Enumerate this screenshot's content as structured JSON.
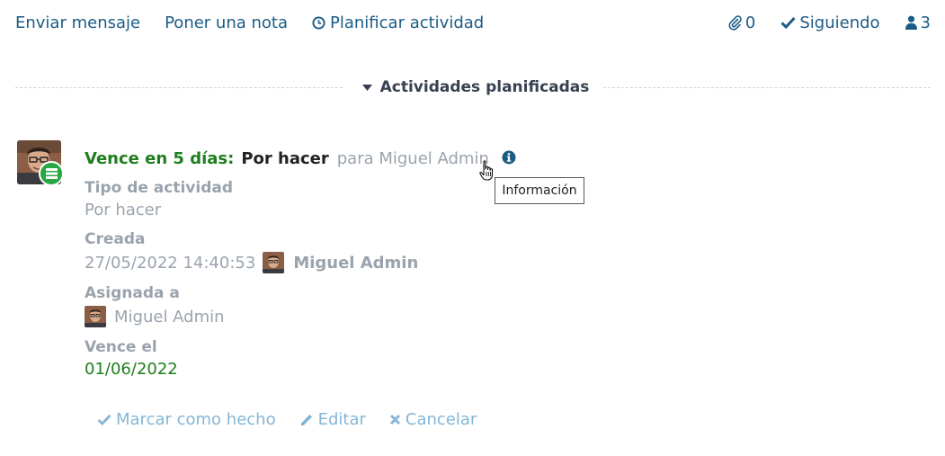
{
  "toolbar": {
    "send_message": "Enviar mensaje",
    "log_note": "Poner una nota",
    "schedule_activity": "Planificar actividad",
    "attachments_count": "0",
    "following": "Siguiendo",
    "followers_count": "3"
  },
  "section": {
    "title": "Actividades planificadas"
  },
  "activity": {
    "due_text": "Vence en 5 días:",
    "type": "Por hacer",
    "for_user": "para Miguel Admin",
    "info_tooltip": "Información",
    "fields": {
      "type_label": "Tipo de actividad",
      "type_value": "Por hacer",
      "created_label": "Creada",
      "created_value": "27/05/2022 14:40:53",
      "created_by": "Miguel Admin",
      "assigned_label": "Asignada a",
      "assigned_value": "Miguel Admin",
      "due_label": "Vence el",
      "due_value": "01/06/2022"
    },
    "actions": {
      "mark_done": "Marcar como hecho",
      "edit": "Editar",
      "cancel": "Cancelar"
    }
  },
  "colors": {
    "link": "#1b5c86",
    "due_green": "#1e7d1e",
    "muted": "#9aa3ad",
    "action_blue": "#84b6d6",
    "badge_green": "#28a745"
  }
}
